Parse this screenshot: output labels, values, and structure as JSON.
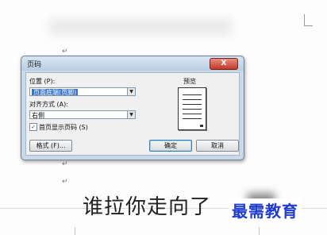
{
  "document": {
    "paragraph_mark": "↵",
    "heading_text": "谁拉你走向了",
    "watermark_text": "最需教育"
  },
  "dialog": {
    "title": "页码",
    "close_label": "X",
    "position_label": "位置 (P):",
    "position_value": "页面底端(页脚)",
    "alignment_label": "对齐方式 (A):",
    "alignment_value": "右侧",
    "first_page_checkbox_label": "首页显示页码 (S)",
    "first_page_checked": true,
    "check_mark": "✓",
    "format_button": "格式 (F)...",
    "preview_label": "预览",
    "ok_button": "确定",
    "cancel_button": "取消"
  },
  "colors": {
    "selection": "#3a72c9",
    "watermark": "#1d3bd0",
    "close_button": "#c0392b"
  }
}
